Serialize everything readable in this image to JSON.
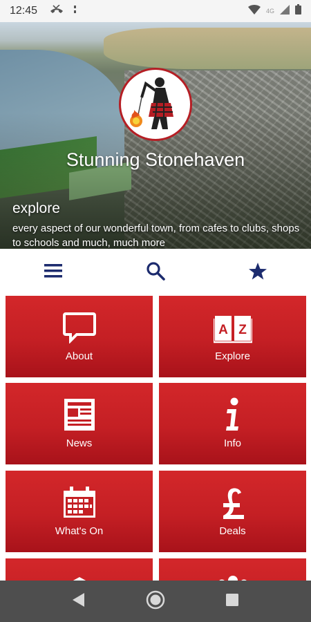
{
  "status_bar": {
    "time": "12:45",
    "network_label": "4G",
    "icons": [
      "missed-call-icon",
      "notification-dots-icon",
      "wifi-icon",
      "cell-signal-icon",
      "battery-icon"
    ]
  },
  "hero": {
    "title": "Stunning Stonehaven",
    "subtitle": "explore",
    "description": "every aspect of our wonderful town, from cafes to clubs, shops to schools and much, much more",
    "carousel_dots": [
      {
        "active": true,
        "color": "#ffffff"
      },
      {
        "active": false,
        "color": "#c41f24"
      },
      {
        "active": false,
        "color": "#c41f24"
      }
    ]
  },
  "toolbar": {
    "menu_icon": "menu-icon",
    "search_icon": "search-icon",
    "favorites_icon": "star-icon",
    "icon_color": "#1c2b6e"
  },
  "tiles": [
    {
      "label": "About",
      "icon": "speech-bubble-icon"
    },
    {
      "label": "Explore",
      "icon": "a-z-book-icon"
    },
    {
      "label": "News",
      "icon": "newspaper-icon"
    },
    {
      "label": "Info",
      "icon": "info-icon"
    },
    {
      "label": "What's On",
      "icon": "calendar-icon"
    },
    {
      "label": "Deals",
      "icon": "pound-icon"
    },
    {
      "label": "",
      "icon": "school-icon"
    },
    {
      "label": "",
      "icon": "group-icon"
    }
  ],
  "colors": {
    "tile_red": "#c41f24",
    "tile_red_dark": "#a8121a",
    "accent_blue": "#1c2b6e",
    "nav_bar": "#4e4e4e"
  },
  "nav_bar": {
    "icons": [
      "back-icon",
      "home-icon",
      "recents-icon"
    ]
  }
}
